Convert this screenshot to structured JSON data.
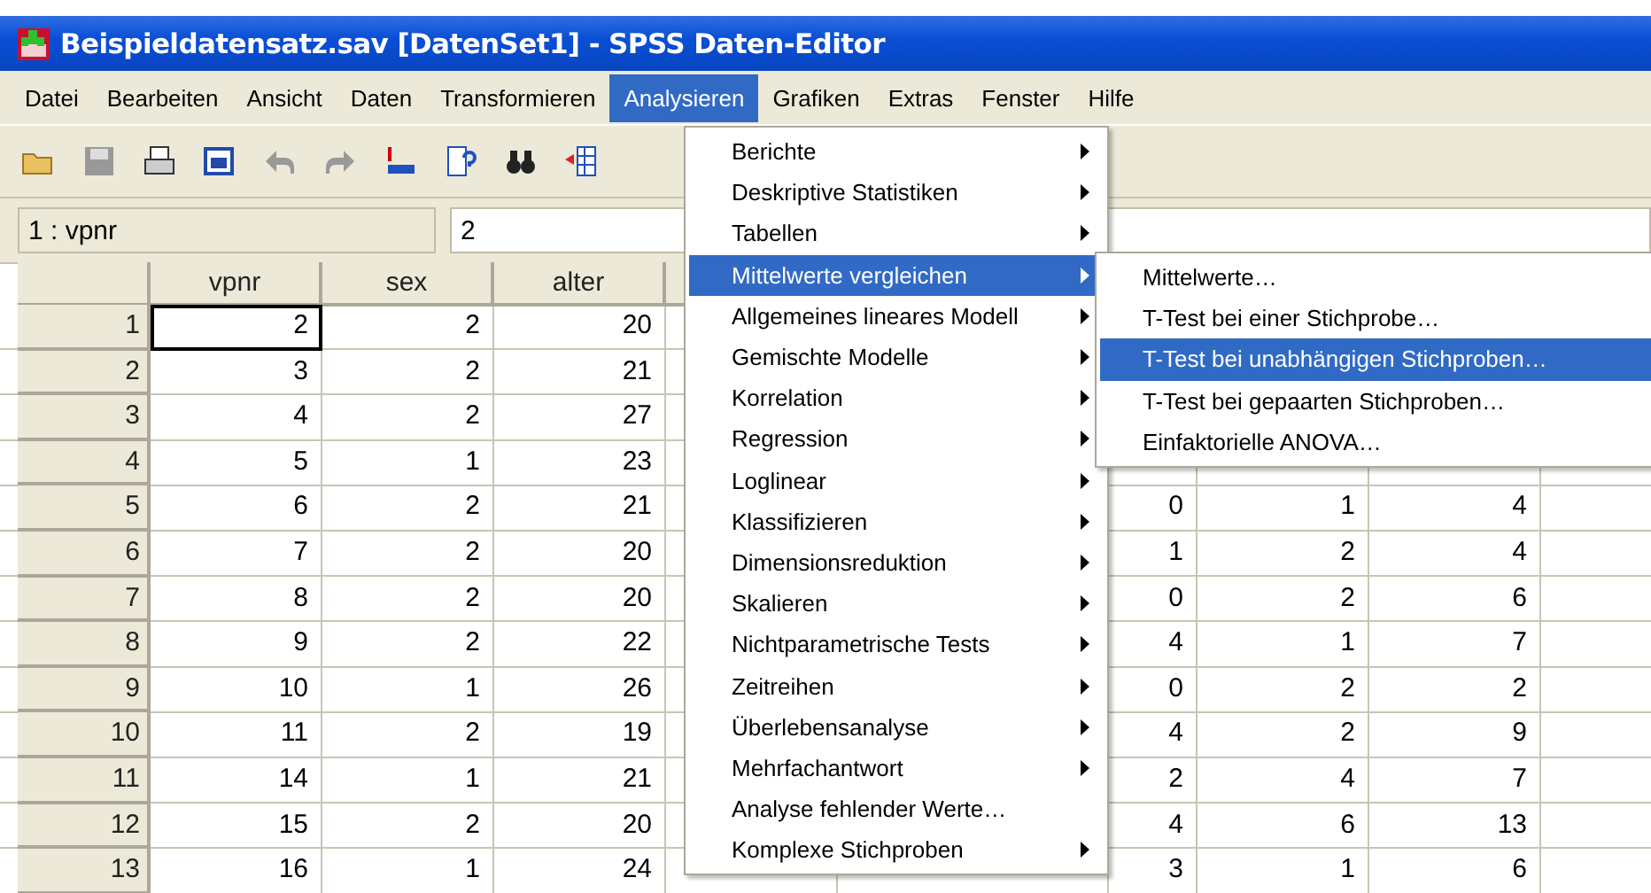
{
  "window": {
    "title": "Beispieldatensatz.sav [DatenSet1] - SPSS Daten-Editor"
  },
  "menu_bar": [
    {
      "label": "Datei",
      "selected": false
    },
    {
      "label": "Bearbeiten",
      "selected": false
    },
    {
      "label": "Ansicht",
      "selected": false
    },
    {
      "label": "Daten",
      "selected": false
    },
    {
      "label": "Transformieren",
      "selected": false
    },
    {
      "label": "Analysieren",
      "selected": true
    },
    {
      "label": "Grafiken",
      "selected": false
    },
    {
      "label": "Extras",
      "selected": false
    },
    {
      "label": "Fenster",
      "selected": false
    },
    {
      "label": "Hilfe",
      "selected": false
    }
  ],
  "cell_reference": "1 : vpnr",
  "cell_value": "2",
  "table": {
    "columns": [
      "vpnr",
      "sex",
      "alter"
    ],
    "rows": [
      {
        "number": "1",
        "current": true,
        "cells": [
          "2",
          "2",
          "20"
        ]
      },
      {
        "number": "2",
        "current": false,
        "cells": [
          "3",
          "2",
          "21"
        ]
      },
      {
        "number": "3",
        "current": false,
        "cells": [
          "4",
          "2",
          "27"
        ]
      },
      {
        "number": "4",
        "current": false,
        "cells": [
          "5",
          "1",
          "23"
        ]
      },
      {
        "number": "5",
        "current": false,
        "cells": [
          "6",
          "2",
          "21",
          null,
          null,
          "0",
          "1",
          "4"
        ]
      },
      {
        "number": "6",
        "current": false,
        "cells": [
          "7",
          "2",
          "20",
          null,
          null,
          "1",
          "2",
          "4"
        ]
      },
      {
        "number": "7",
        "current": false,
        "cells": [
          "8",
          "2",
          "20",
          null,
          null,
          "0",
          "2",
          "6"
        ]
      },
      {
        "number": "8",
        "current": false,
        "cells": [
          "9",
          "2",
          "22",
          null,
          null,
          "4",
          "1",
          "7"
        ]
      },
      {
        "number": "9",
        "current": false,
        "cells": [
          "10",
          "1",
          "26",
          null,
          null,
          "0",
          "2",
          "2"
        ]
      },
      {
        "number": "10",
        "current": false,
        "cells": [
          "11",
          "2",
          "19",
          null,
          null,
          "4",
          "2",
          "9"
        ]
      },
      {
        "number": "11",
        "current": false,
        "cells": [
          "14",
          "1",
          "21",
          null,
          null,
          "2",
          "4",
          "7"
        ]
      },
      {
        "number": "12",
        "current": false,
        "cells": [
          "15",
          "2",
          "20",
          null,
          null,
          "4",
          "6",
          "13"
        ]
      },
      {
        "number": "13",
        "current": false,
        "cells": [
          "16",
          "1",
          "24",
          null,
          null,
          "3",
          "1",
          "6"
        ]
      }
    ]
  },
  "dropdown_menu": {
    "items": [
      {
        "label": "Berichte",
        "submenu": true,
        "selected": false
      },
      {
        "label": "Deskriptive Statistiken",
        "submenu": true,
        "selected": false
      },
      {
        "label": "Tabellen",
        "submenu": true,
        "selected": false
      },
      {
        "label": "Mittelwerte vergleichen",
        "submenu": true,
        "selected": true
      },
      {
        "label": "Allgemeines lineares Modell",
        "submenu": true,
        "selected": false
      },
      {
        "label": "Gemischte Modelle",
        "submenu": true,
        "selected": false
      },
      {
        "label": "Korrelation",
        "submenu": true,
        "selected": false
      },
      {
        "label": "Regression",
        "submenu": true,
        "selected": false
      },
      {
        "label": "Loglinear",
        "submenu": true,
        "selected": false
      },
      {
        "label": "Klassifizieren",
        "submenu": true,
        "selected": false
      },
      {
        "label": "Dimensionsreduktion",
        "submenu": true,
        "selected": false
      },
      {
        "label": "Skalieren",
        "submenu": true,
        "selected": false
      },
      {
        "label": "Nichtparametrische Tests",
        "submenu": true,
        "selected": false
      },
      {
        "label": "Zeitreihen",
        "submenu": true,
        "selected": false
      },
      {
        "label": "Überlebensanalyse",
        "submenu": true,
        "selected": false
      },
      {
        "label": "Mehrfachantwort",
        "submenu": true,
        "selected": false
      },
      {
        "label": "Analyse fehlender Werte…",
        "submenu": false,
        "selected": false
      },
      {
        "label": "Komplexe Stichproben",
        "submenu": true,
        "selected": false
      }
    ]
  },
  "submenu": {
    "items": [
      {
        "label": "Mittelwerte…",
        "selected": false
      },
      {
        "label": "T-Test bei einer Stichprobe…",
        "selected": false
      },
      {
        "label": "T-Test bei unabhängigen Stichproben…",
        "selected": true
      },
      {
        "label": "T-Test bei gepaarten Stichproben…",
        "selected": false
      },
      {
        "label": "Einfaktorielle ANOVA…",
        "selected": false
      }
    ]
  }
}
